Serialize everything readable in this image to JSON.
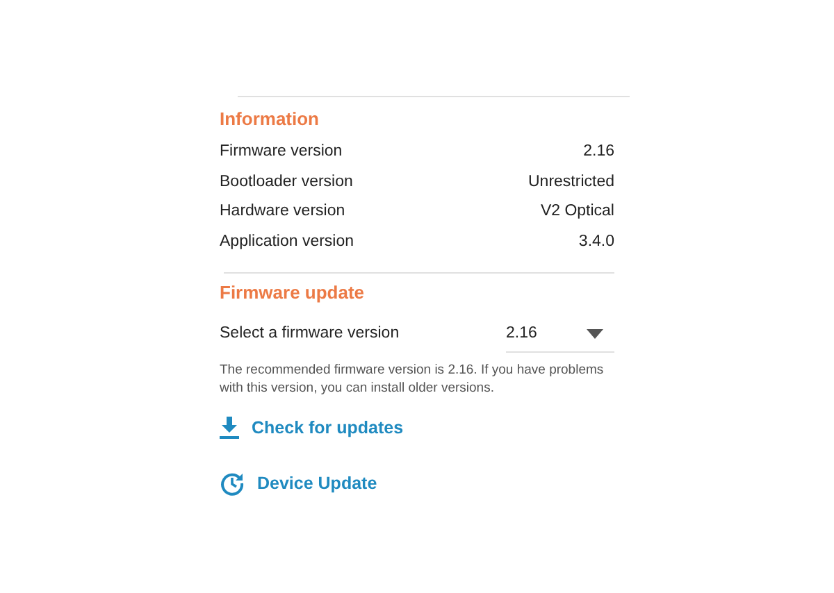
{
  "information": {
    "title": "Information",
    "rows": [
      {
        "label": "Firmware version",
        "value": "2.16"
      },
      {
        "label": "Bootloader version",
        "value": "Unrestricted"
      },
      {
        "label": "Hardware version",
        "value": "V2 Optical"
      },
      {
        "label": "Application version",
        "value": "3.4.0"
      }
    ]
  },
  "firmware_update": {
    "title": "Firmware update",
    "select": {
      "label": "Select a firmware version",
      "value": "2.16"
    },
    "note": "The recommended firmware version is 2.16. If you have problems with this version, you can install older versions.",
    "actions": [
      {
        "kind": "download",
        "label": "Check for updates"
      },
      {
        "kind": "history",
        "label": "Device Update"
      }
    ]
  }
}
